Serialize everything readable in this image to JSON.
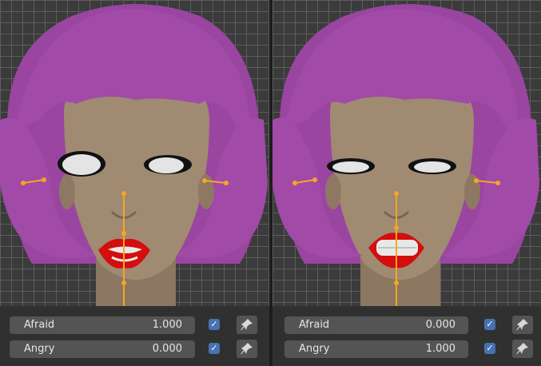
{
  "panels": [
    {
      "shape_keys": [
        {
          "label": "Afraid",
          "value": "1.000",
          "enabled": true
        },
        {
          "label": "Angry",
          "value": "0.000",
          "enabled": true
        }
      ],
      "expression": "afraid"
    },
    {
      "shape_keys": [
        {
          "label": "Afraid",
          "value": "0.000",
          "enabled": true
        },
        {
          "label": "Angry",
          "value": "1.000",
          "enabled": true
        }
      ],
      "expression": "angry"
    }
  ],
  "icons": {
    "checkbox": "checkbox-icon",
    "pin": "pin-icon"
  },
  "colors": {
    "hair": "#a24aa8",
    "skin": "#a08a72",
    "lips": "#d40d0d",
    "bone": "#f5a623",
    "accent": "#4772b3"
  }
}
